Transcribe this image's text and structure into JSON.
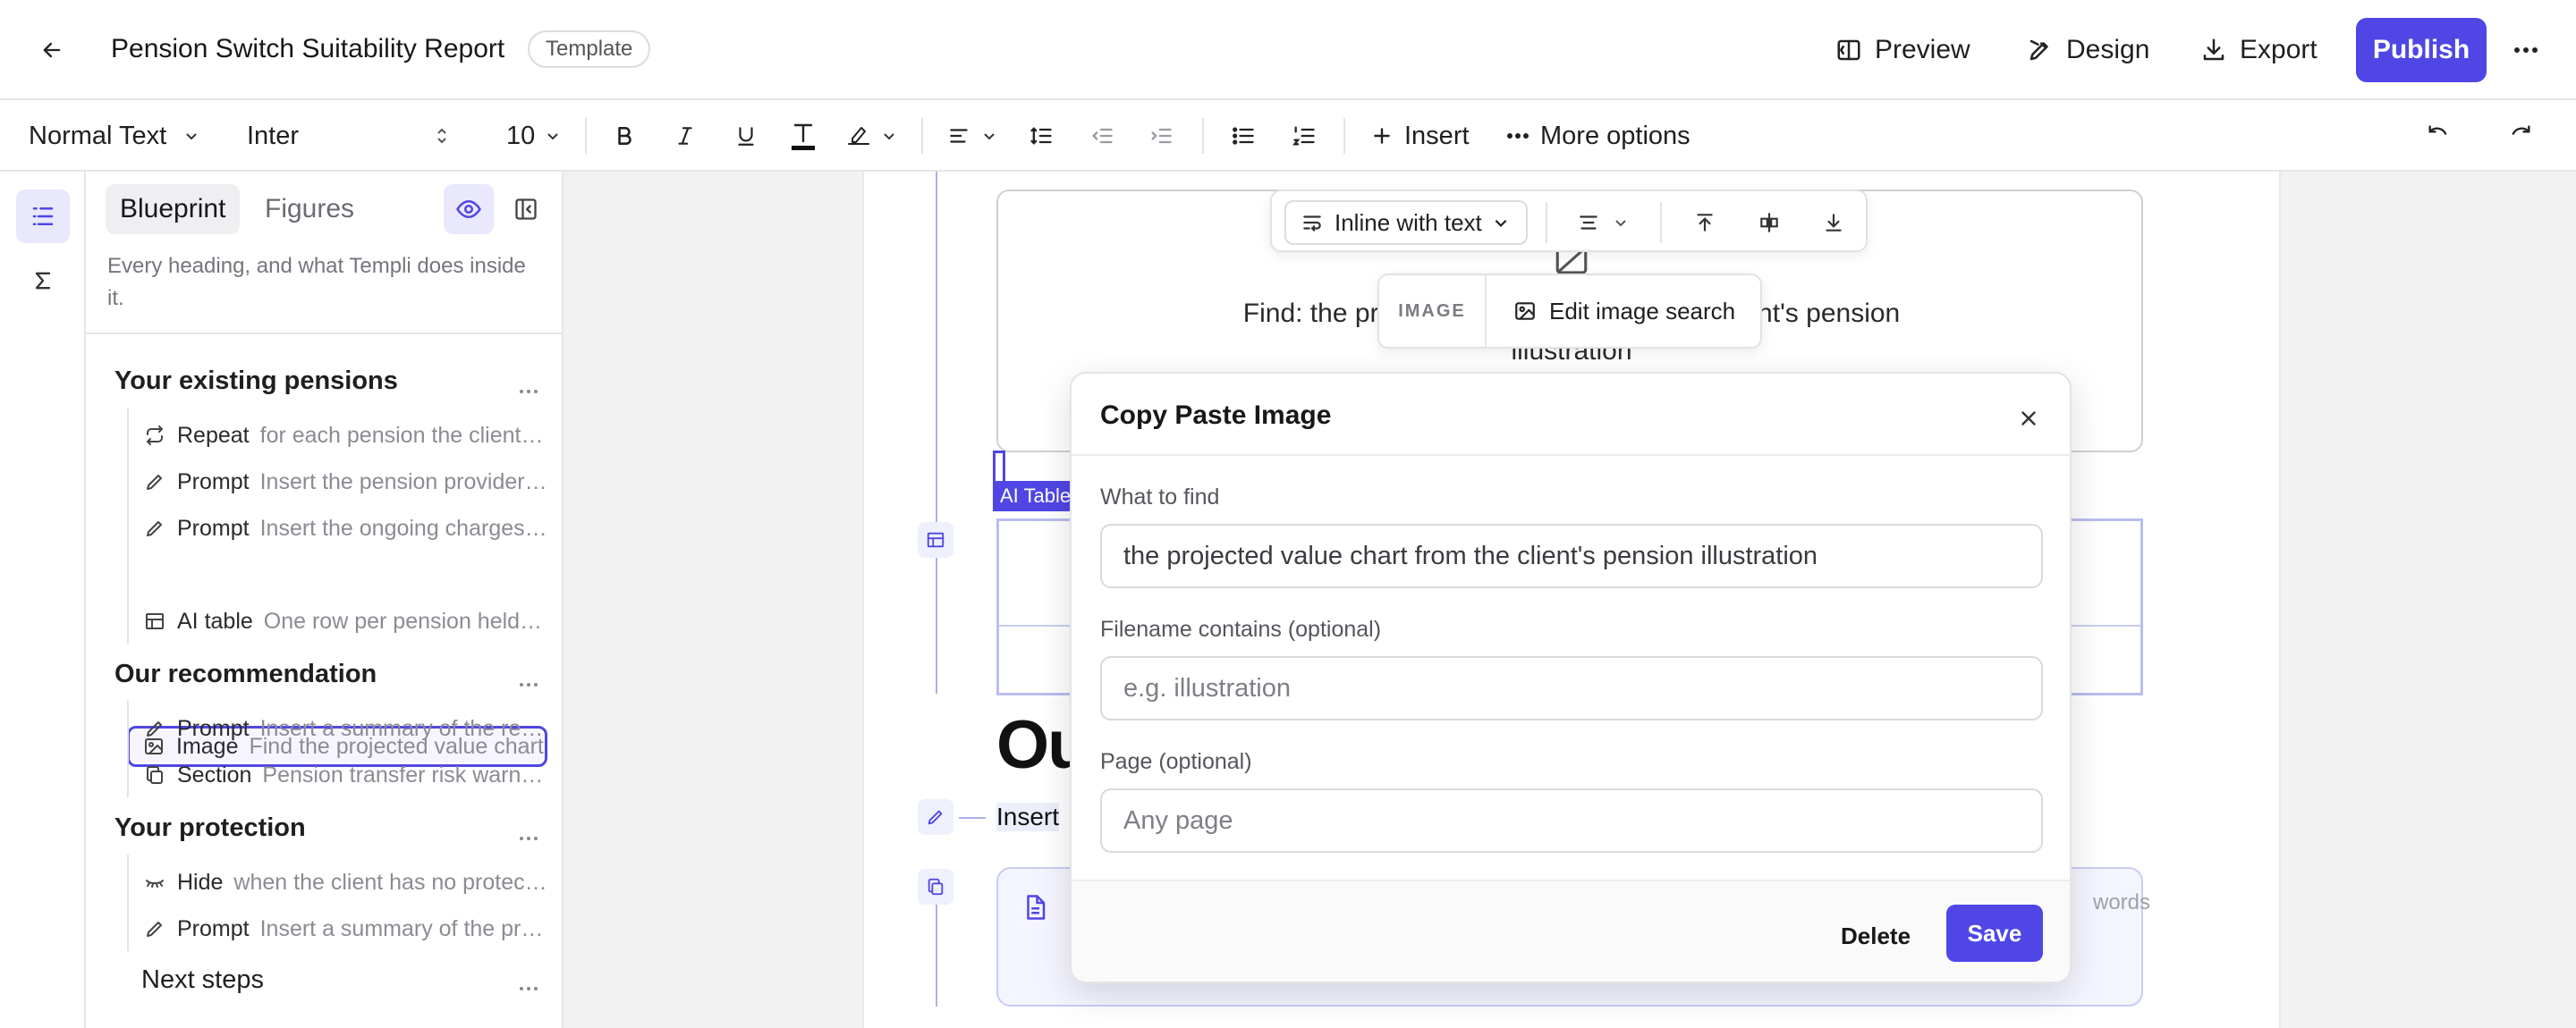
{
  "header": {
    "title": "Pension Switch Suitability Report",
    "badge": "Template",
    "preview": "Preview",
    "design": "Design",
    "export": "Export",
    "publish": "Publish"
  },
  "toolbar": {
    "text_style": "Normal Text",
    "font": "Inter",
    "font_size": "10",
    "insert": "Insert",
    "more_options": "More options"
  },
  "sidebar": {
    "tabs": [
      "Blueprint",
      "Figures"
    ],
    "description": "Every heading, and what Templi does inside it.",
    "sections": [
      {
        "title": "Your existing pensions",
        "items": [
          {
            "type": "Repeat",
            "desc": "for each pension the client holds",
            "icon": "repeat-icon"
          },
          {
            "type": "Prompt",
            "desc": "Insert the pension provider and plan details",
            "icon": "pen-icon"
          },
          {
            "type": "Prompt",
            "desc": "Insert the ongoing charges for each plan",
            "icon": "pen-icon"
          },
          {
            "type": "Image",
            "desc": "Find the projected value chart",
            "icon": "image-icon"
          },
          {
            "type": "AI table",
            "desc": "One row per pension held by the client",
            "icon": "table-icon"
          }
        ]
      },
      {
        "title": "Our recommendation",
        "items": [
          {
            "type": "Prompt",
            "desc": "Insert a summary of the recommendation",
            "icon": "pen-icon"
          },
          {
            "type": "Section",
            "desc": "Pension transfer risk warnings",
            "icon": "copy-icon"
          }
        ]
      },
      {
        "title": "Your protection",
        "items": [
          {
            "type": "Hide",
            "desc": "when the client has no protection in place",
            "icon": "eye-closed-icon"
          },
          {
            "type": "Prompt",
            "desc": "Insert a summary of the protection",
            "icon": "pen-icon"
          }
        ]
      },
      {
        "title": "Next steps",
        "items": []
      }
    ]
  },
  "canvas": {
    "image_find_line1": "Find: the projected value chart from the client's pension",
    "image_find_line2": "illustration",
    "ai_table_tag": "AI Table",
    "heading_fragment": "Ou",
    "insert_fragment": "Insert",
    "words_fragment": "words"
  },
  "image_toolbar": {
    "layout": "Inline with text",
    "kind": "IMAGE",
    "edit": "Edit image search"
  },
  "modal": {
    "title": "Copy Paste Image",
    "what_label": "What to find",
    "what_value": "the projected value chart from the client's pension illustration",
    "filename_label": "Filename contains (optional)",
    "filename_placeholder": "e.g. illustration",
    "page_label": "Page (optional)",
    "page_placeholder": "Any page",
    "delete": "Delete",
    "save": "Save"
  },
  "colors": {
    "accent": "#4f46e5",
    "text": "#1f1f22",
    "muted": "#8b8b93"
  }
}
